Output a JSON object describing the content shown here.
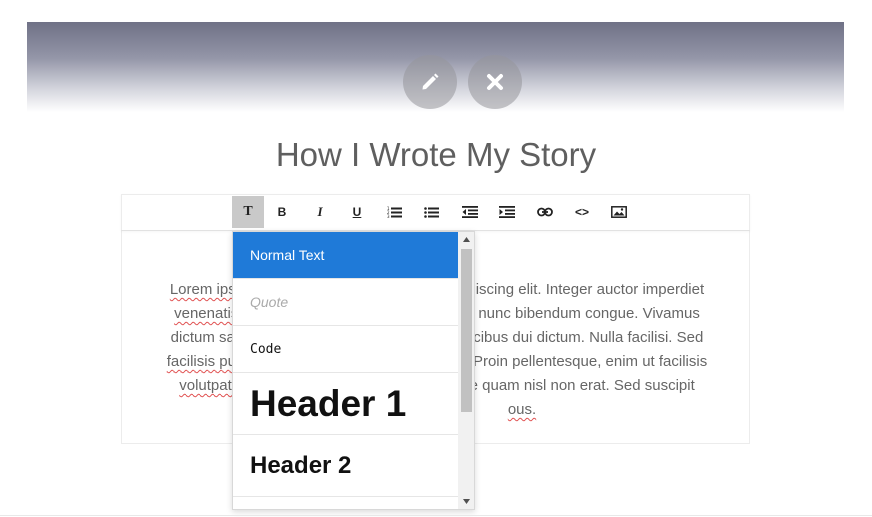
{
  "story": {
    "title": "How I Wrote My Story"
  },
  "hero": {
    "edit_icon": "pencil-icon",
    "close_icon": "close-icon"
  },
  "toolbar": {
    "buttons": [
      {
        "name": "text-style",
        "label": "T",
        "icon": "text-style-icon",
        "active": true
      },
      {
        "name": "bold",
        "label": "B",
        "icon": "bold-icon"
      },
      {
        "name": "italic",
        "label": "I",
        "icon": "italic-icon"
      },
      {
        "name": "underline",
        "label": "U",
        "icon": "underline-icon"
      },
      {
        "name": "ordered-list",
        "icon": "ordered-list-icon"
      },
      {
        "name": "unordered-list",
        "icon": "unordered-list-icon"
      },
      {
        "name": "outdent",
        "icon": "outdent-icon"
      },
      {
        "name": "indent",
        "icon": "indent-icon"
      },
      {
        "name": "link",
        "icon": "link-icon"
      },
      {
        "name": "code",
        "label": "<>",
        "icon": "code-icon"
      },
      {
        "name": "image",
        "icon": "image-icon"
      }
    ]
  },
  "body": {
    "line1_a": "Lorem ips",
    "line1_b": "iscing elit. Integer auctor imperdiet",
    "line2_a": "venenatis",
    "line2_b": "nunc bibendum congue. Vivamus",
    "line3_a": "dictum sap",
    "line3_b": "cibus dui dictum. Nulla facilisi. Sed",
    "line4_a": "facilisis pur",
    "line4_b": "Proin pellentesque, enim ut facilisis",
    "line5_a": "volutpat, c",
    "line5_b": "e quam nisl non erat. Sed suscipit",
    "line6_b": "ous."
  },
  "dropdown": {
    "items": [
      {
        "label": "Normal Text",
        "selected": true
      },
      {
        "label": "Quote"
      },
      {
        "label": "Code"
      },
      {
        "label": "Header 1"
      },
      {
        "label": "Header 2"
      }
    ]
  },
  "colors": {
    "accent": "#1f7ad8",
    "hero_top": "#6f7186"
  }
}
